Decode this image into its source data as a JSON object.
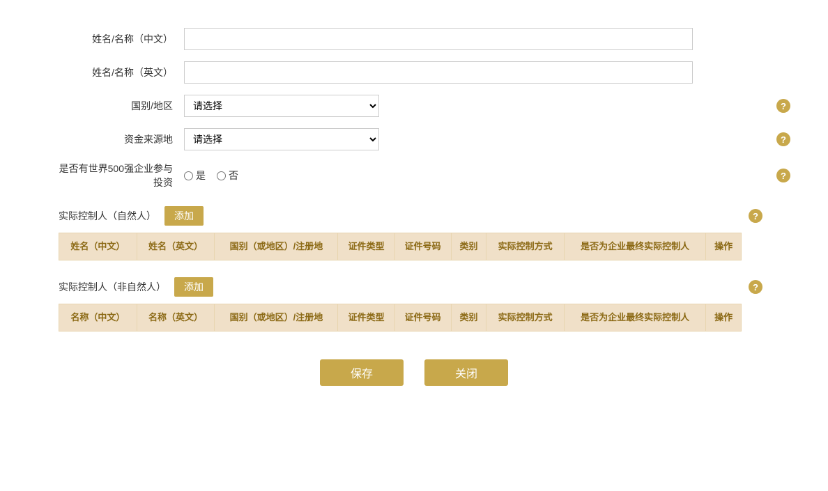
{
  "form": {
    "name_cn_label": "姓名/名称（中文）",
    "name_en_label": "姓名/名称（英文）",
    "country_label": "国别/地区",
    "fund_source_label": "资金来源地",
    "fortune500_label": "是否有世界500强企业参与投资",
    "fortune500_yes": "是",
    "fortune500_no": "否",
    "select_placeholder": "请选择",
    "name_cn_value": "",
    "name_en_value": ""
  },
  "section1": {
    "title": "实际控制人（自然人）",
    "add_btn": "添加",
    "columns": [
      "姓名（中文）",
      "姓名（英文）",
      "国别（或地区）/注册地",
      "证件类型",
      "证件号码",
      "类别",
      "实际控制方式",
      "是否为企业最终实际控制人",
      "操作"
    ]
  },
  "section2": {
    "title": "实际控制人（非自然人）",
    "add_btn": "添加",
    "columns": [
      "名称（中文）",
      "名称（英文）",
      "国别（或地区）/注册地",
      "证件类型",
      "证件号码",
      "类别",
      "实际控制方式",
      "是否为企业最终实际控制人",
      "操作"
    ]
  },
  "actions": {
    "save": "保存",
    "close": "关闭"
  },
  "help_icon_char": "?",
  "colors": {
    "gold": "#c8a84b",
    "table_header_bg": "#f0e0c8",
    "table_header_color": "#8b6914"
  }
}
